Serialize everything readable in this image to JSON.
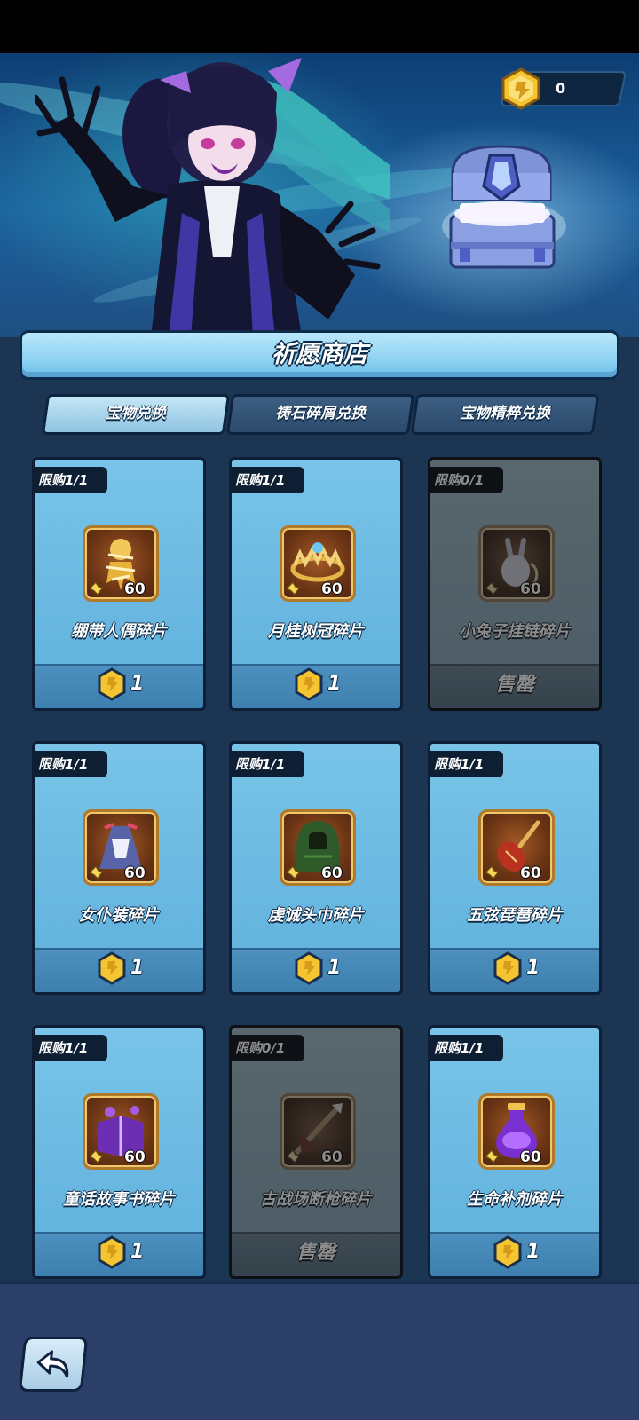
{
  "currency": {
    "icon": "gold-hex-coin-icon",
    "value": "0"
  },
  "shop": {
    "title": "祈愿商店"
  },
  "tabs": [
    {
      "label": "宝物兑换",
      "active": true
    },
    {
      "label": "祷石碎屑兑换",
      "active": false
    },
    {
      "label": "宝物精粹兑换",
      "active": false
    }
  ],
  "items": [
    {
      "limit": "限购1/1",
      "name": "绷带人偶碎片",
      "shards": "60",
      "price": "1",
      "sold_out": false,
      "icon": "bandage-doll-icon"
    },
    {
      "limit": "限购1/1",
      "name": "月桂树冠碎片",
      "shards": "60",
      "price": "1",
      "sold_out": false,
      "icon": "laurel-crown-icon"
    },
    {
      "limit": "限购0/1",
      "name": "小兔子挂链碎片",
      "shards": "60",
      "price": "",
      "sold_out": true,
      "sold_out_label": "售罄",
      "icon": "bunny-charm-icon"
    },
    {
      "limit": "限购1/1",
      "name": "女仆装碎片",
      "shards": "60",
      "price": "1",
      "sold_out": false,
      "icon": "maid-dress-icon"
    },
    {
      "limit": "限购1/1",
      "name": "虔诚头巾碎片",
      "shards": "60",
      "price": "1",
      "sold_out": false,
      "icon": "hood-cloak-icon"
    },
    {
      "limit": "限购1/1",
      "name": "五弦琵琶碎片",
      "shards": "60",
      "price": "1",
      "sold_out": false,
      "icon": "pipa-lute-icon"
    },
    {
      "limit": "限购1/1",
      "name": "童话故事书碎片",
      "shards": "60",
      "price": "1",
      "sold_out": false,
      "icon": "storybook-icon"
    },
    {
      "limit": "限购0/1",
      "name": "古战场断枪碎片",
      "shards": "60",
      "price": "",
      "sold_out": true,
      "sold_out_label": "售罄",
      "icon": "broken-spear-icon"
    },
    {
      "limit": "限购1/1",
      "name": "生命补剂碎片",
      "shards": "60",
      "price": "1",
      "sold_out": false,
      "icon": "life-potion-icon"
    }
  ],
  "navigation": {
    "back_icon": "back-arrow-icon"
  },
  "colors": {
    "panel_bg": "#1b3552",
    "card_bg": "#79c4e8",
    "title_bar": "#8fd2f2",
    "coin": "#f4c531"
  }
}
